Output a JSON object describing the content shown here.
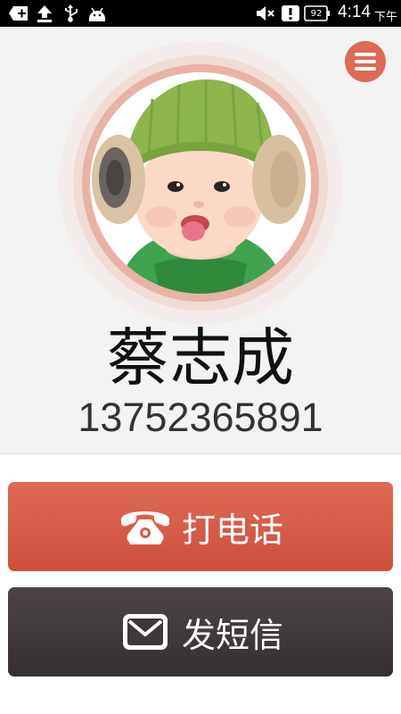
{
  "status_bar": {
    "battery_level": "92",
    "time": "4:14",
    "am_pm": "下午"
  },
  "contact": {
    "name": "蔡志成",
    "number": "13752365891"
  },
  "actions": {
    "call_label": "打电话",
    "sms_label": "发短信"
  },
  "colors": {
    "accent": "#dd6a55",
    "call_button": "#d55b47",
    "sms_button": "#3f3738",
    "header_bg": "#f3f3f3"
  },
  "icons": {
    "menu": "hamburger-icon",
    "call": "telephone-icon",
    "sms": "envelope-icon"
  }
}
